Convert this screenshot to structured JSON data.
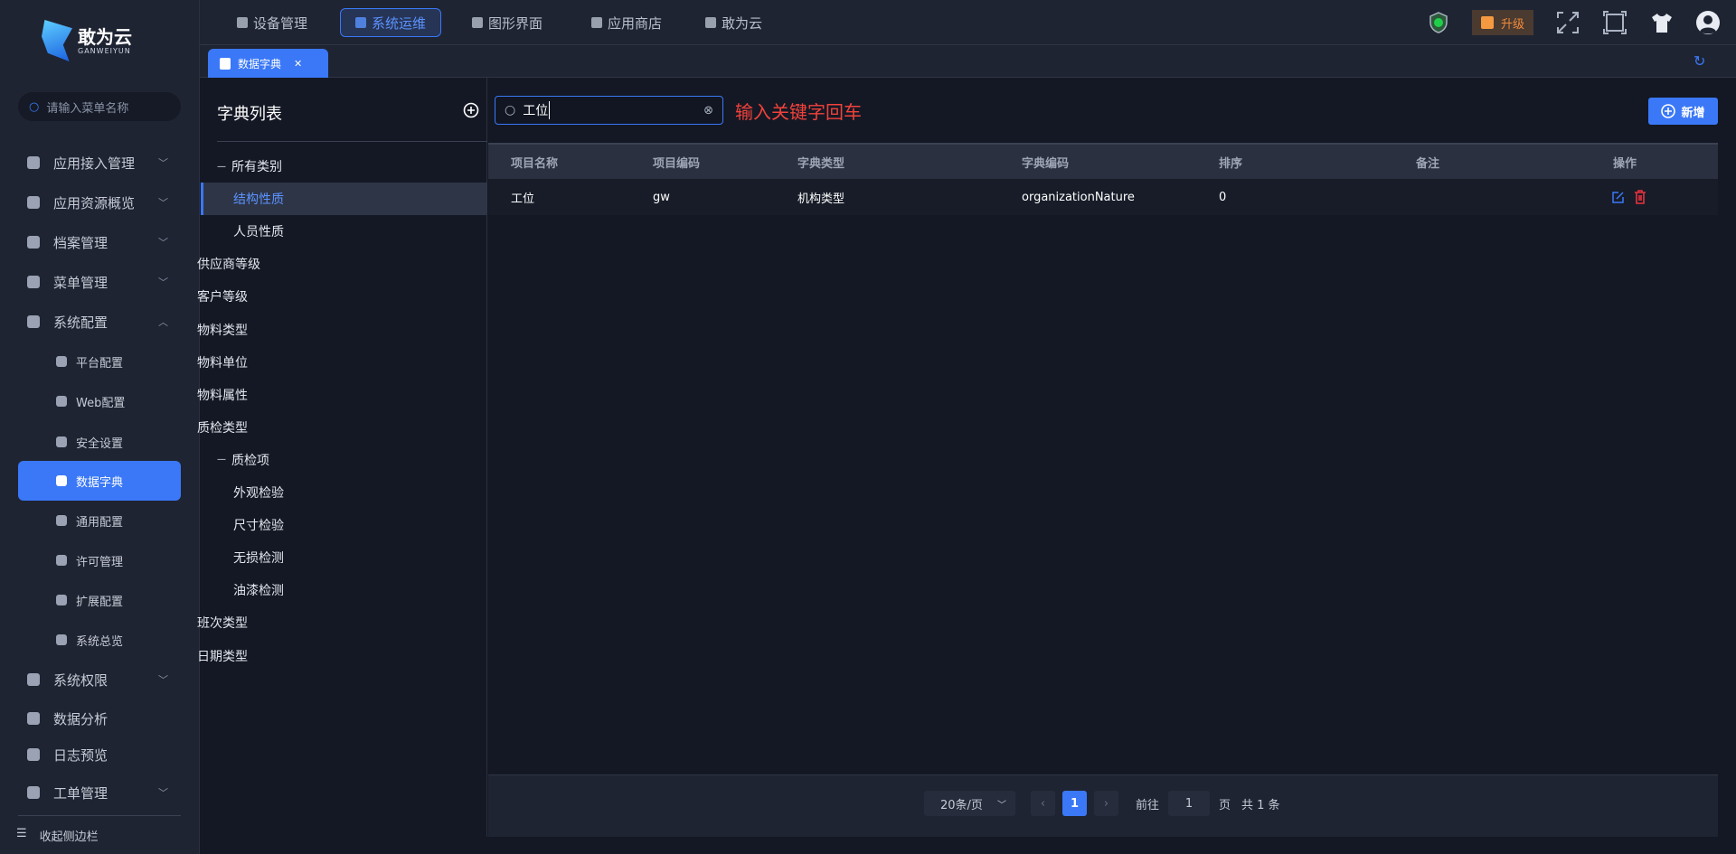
{
  "sidebar": {
    "logo": {
      "name": "敢为云",
      "sub": "GANWEIYUN"
    },
    "search_placeholder": "请输入菜单名称",
    "items": [
      {
        "label": "应用接入管理",
        "icon": "home-icon",
        "chev": "﹀"
      },
      {
        "label": "应用资源概览",
        "icon": "layers-icon",
        "chev": "﹀"
      },
      {
        "label": "档案管理",
        "icon": "archive-icon",
        "chev": "﹀"
      },
      {
        "label": "菜单管理",
        "icon": "menu-icon",
        "chev": "﹀"
      },
      {
        "label": "系统配置",
        "icon": "home-icon",
        "chev": "︿"
      }
    ],
    "sub_items": [
      "平台配置",
      "Web配置",
      "安全设置",
      "数据字典",
      "通用配置",
      "许可管理",
      "扩展配置",
      "系统总览"
    ],
    "items2": [
      {
        "label": "系统权限",
        "chev": "﹀"
      },
      {
        "label": "数据分析",
        "chev": ""
      },
      {
        "label": "日志预览",
        "chev": ""
      },
      {
        "label": "工单管理",
        "chev": "﹀"
      }
    ],
    "collapse": "收起侧边栏"
  },
  "topnav": {
    "tabs": [
      "设备管理",
      "系统运维",
      "图形界面",
      "应用商店",
      "敢为云"
    ],
    "active": 1,
    "upgrade": "升级"
  },
  "page_tab": {
    "label": "数据字典",
    "close": "✕"
  },
  "dict": {
    "title": "字典列表",
    "tree": [
      {
        "label": "所有类别",
        "level": 0,
        "toggle": "—"
      },
      {
        "label": "结构性质",
        "level": 1,
        "active": true
      },
      {
        "label": "人员性质",
        "level": 1
      },
      {
        "label": "供应商等级",
        "level": 0
      },
      {
        "label": "客户等级",
        "level": 0
      },
      {
        "label": "物料类型",
        "level": 0
      },
      {
        "label": "物料单位",
        "level": 0
      },
      {
        "label": "物料属性",
        "level": 0
      },
      {
        "label": "质检类型",
        "level": 0
      },
      {
        "label": "质检项",
        "level": 0,
        "toggle": "—"
      },
      {
        "label": "外观检验",
        "level": 1
      },
      {
        "label": "尺寸检验",
        "level": 1
      },
      {
        "label": "无损检测",
        "level": 1
      },
      {
        "label": "油漆检测",
        "level": 1
      },
      {
        "label": "班次类型",
        "level": 0
      },
      {
        "label": "日期类型",
        "level": 0
      }
    ]
  },
  "main": {
    "search_value": "工位",
    "hint": "输入关键字回车",
    "add_label": "新增",
    "columns": [
      "项目名称",
      "项目编码",
      "字典类型",
      "字典编码",
      "排序",
      "备注",
      "操作"
    ],
    "rows": [
      [
        "工位",
        "gw",
        "机构类型",
        "organizationNature",
        "0",
        ""
      ]
    ],
    "pager": {
      "page_size": "20条/页",
      "current": "1",
      "goto_label": "前往",
      "goto_value": "1",
      "page_unit": "页",
      "total": "共 1 条"
    }
  },
  "colors": {
    "accent": "#3a78f7",
    "hint": "#f0423b",
    "delete": "#e8323c"
  }
}
